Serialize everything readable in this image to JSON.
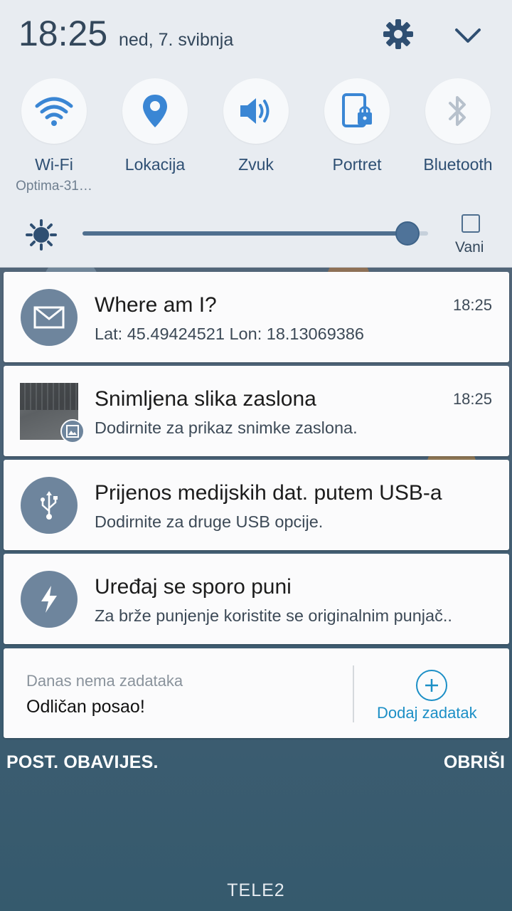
{
  "status": {
    "time": "18:25",
    "date": "ned, 7. svibnja"
  },
  "quick_settings": {
    "tiles": [
      {
        "label": "Wi-Fi",
        "sub": "Optima-31…",
        "icon": "wifi-icon",
        "active": true
      },
      {
        "label": "Lokacija",
        "sub": "",
        "icon": "location-icon",
        "active": true
      },
      {
        "label": "Zvuk",
        "sub": "",
        "icon": "sound-icon",
        "active": true
      },
      {
        "label": "Portret",
        "sub": "",
        "icon": "portrait-lock-icon",
        "active": true
      },
      {
        "label": "Bluetooth",
        "sub": "",
        "icon": "bluetooth-icon",
        "active": false
      }
    ],
    "brightness_level": 0.94,
    "auto_label": "Vani"
  },
  "notifications": [
    {
      "title": "Where am I?",
      "body": "Lat: 45.49424521 Lon: 18.13069386",
      "time": "18:25",
      "icon": "mail-icon"
    },
    {
      "title": "Snimljena slika zaslona",
      "body": "Dodirnite za prikaz snimke zaslona.",
      "time": "18:25",
      "icon": "image-icon"
    },
    {
      "title": "Prijenos medijskih dat. putem USB-a",
      "body": "Dodirnite za druge USB opcije.",
      "time": "",
      "icon": "usb-icon"
    },
    {
      "title": "Uređaj se sporo puni",
      "body": "Za brže punjenje koristite se originalnim punjač..",
      "time": "",
      "icon": "lightning-icon"
    }
  ],
  "tasks": {
    "subtitle": "Danas nema zadataka",
    "main": "Odličan posao!",
    "add_label": "Dodaj zadatak"
  },
  "footer": {
    "settings_label": "POST. OBAVIJES.",
    "clear_label": "OBRIŠI"
  },
  "carrier": "TELE2",
  "colors": {
    "panel_bg": "#e8ecf1",
    "accent_blue": "#3a86d4",
    "icon_circle": "#6e859d",
    "task_accent": "#1c8fc6"
  }
}
